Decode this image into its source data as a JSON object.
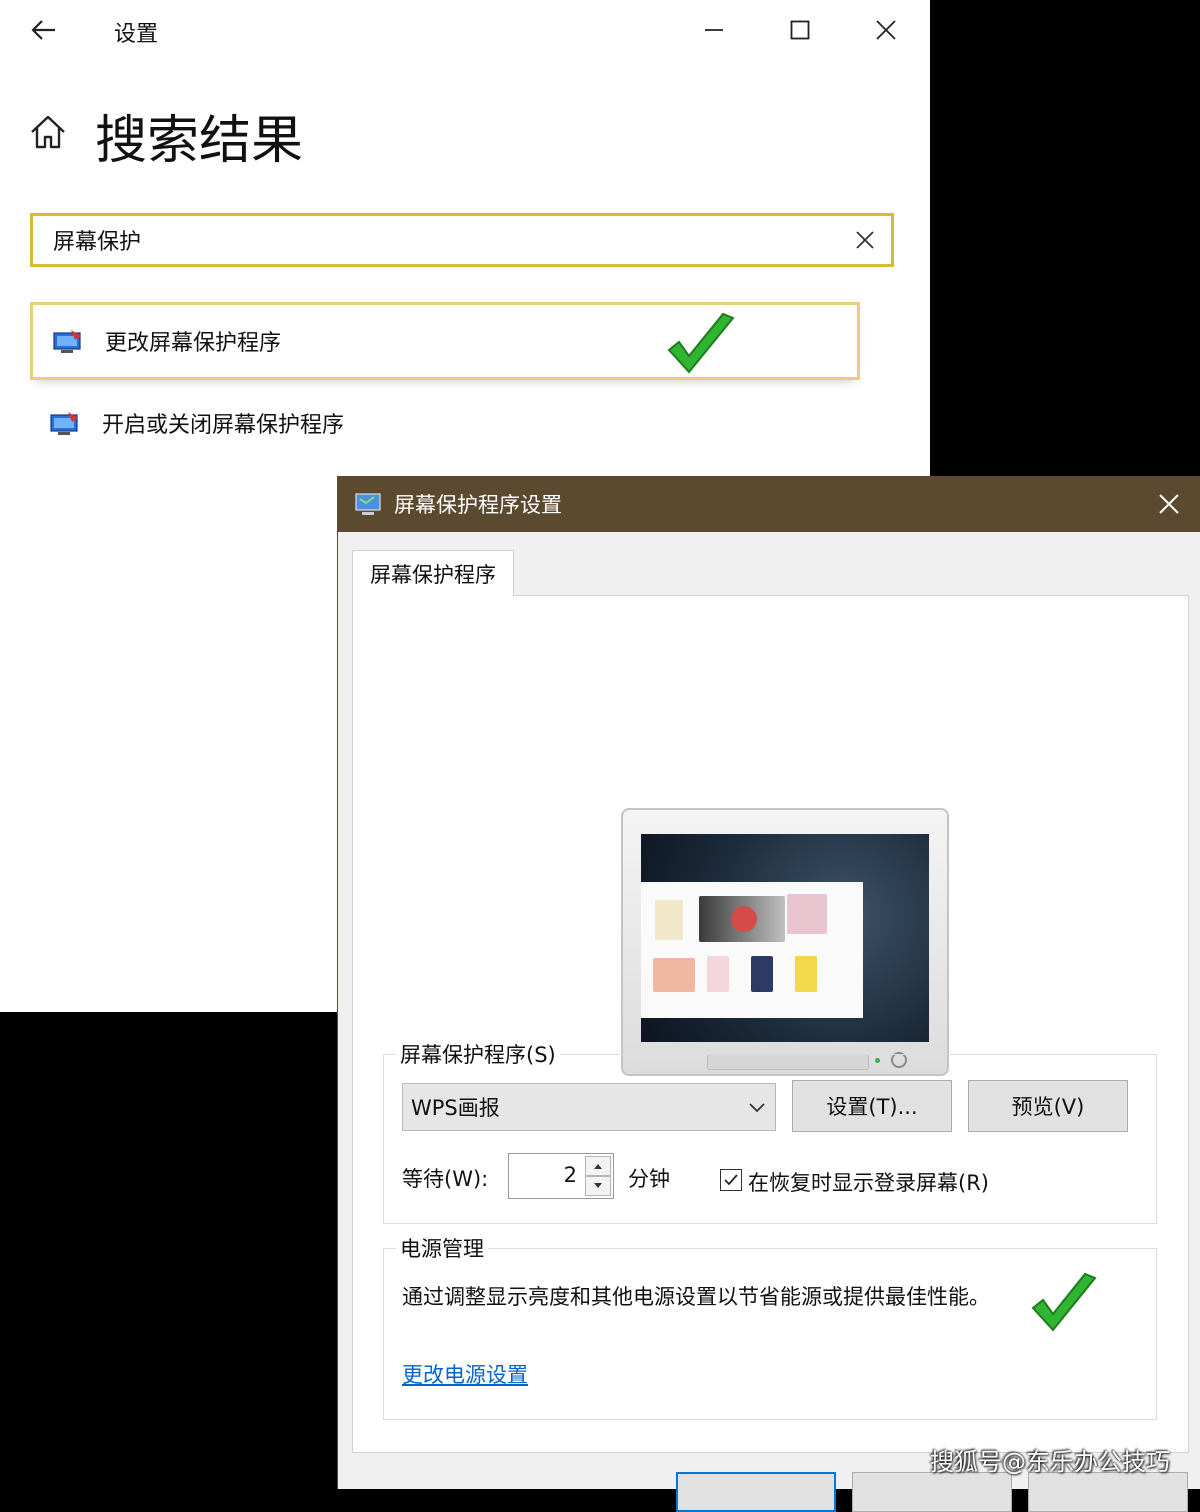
{
  "settings_window": {
    "app_title": "设置",
    "page_title": "搜索结果",
    "search": {
      "value": "屏幕保护"
    },
    "results": [
      {
        "label": "更改屏幕保护程序"
      },
      {
        "label": "开启或关闭屏幕保护程序"
      }
    ]
  },
  "dialog": {
    "title": "屏幕保护程序设置",
    "tab_label": "屏幕保护程序",
    "screensaver_group": {
      "label": "屏幕保护程序(S)",
      "selected": "WPS画报",
      "settings_button": "设置(T)...",
      "preview_button": "预览(V)",
      "wait_label": "等待(W):",
      "wait_value": "2",
      "unit_label": "分钟",
      "resume_checkbox_label": "在恢复时显示登录屏幕(R)",
      "resume_checked": true
    },
    "power_group": {
      "label": "电源管理",
      "description": "通过调整显示亮度和其他电源设置以节省能源或提供最佳性能。",
      "link": "更改电源设置"
    }
  },
  "watermark": "搜狐号@东乐办公技巧",
  "colors": {
    "search_highlight": "#d8b933",
    "dialog_titlebar": "#5b4a2f",
    "check_mark": "#2fb52f",
    "link": "#0066cc"
  },
  "icons": [
    "back-arrow-icon",
    "minimize-icon",
    "maximize-icon",
    "close-icon",
    "home-icon",
    "clear-icon",
    "screensaver-icon",
    "check-mark-icon",
    "chevron-down-icon"
  ]
}
